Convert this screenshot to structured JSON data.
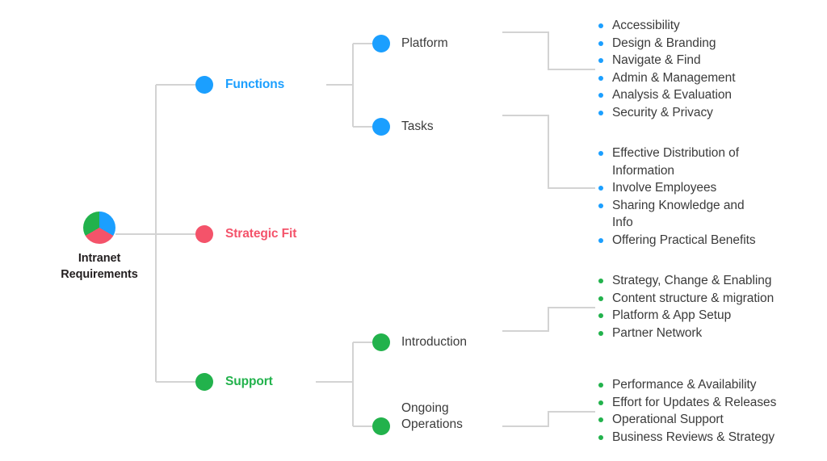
{
  "diagram": {
    "title": "Intranet Requirements mind map",
    "root": {
      "label_line1": "Intranet",
      "label_line2": "Requirements",
      "icon": "pie-chart",
      "segment_colors": [
        "#1b9fff",
        "#f4536a",
        "#22b24c"
      ]
    },
    "colors": {
      "functions": "#1b9fff",
      "strategic_fit": "#f4536a",
      "support": "#22b24c",
      "node_text": "#3b3b3b",
      "root_text": "#231f20",
      "connector": "#d3d3d3"
    },
    "branches": {
      "functions": {
        "label": "Functions",
        "children": {
          "platform": {
            "label": "Platform",
            "items": [
              "Accessibility",
              "Design & Branding",
              "Navigate & Find",
              "Admin & Management",
              "Analysis & Evaluation",
              "Security & Privacy"
            ]
          },
          "tasks": {
            "label": "Tasks",
            "items": [
              "Effective Distribution of Information",
              "Involve Employees",
              "Sharing Knowledge and Info",
              "Offering Practical Benefits"
            ]
          }
        }
      },
      "strategic_fit": {
        "label": "Strategic Fit"
      },
      "support": {
        "label": "Support",
        "children": {
          "introduction": {
            "label": "Introduction",
            "items": [
              "Strategy, Change & Enabling",
              "Content structure & migration",
              "Platform & App Setup",
              "Partner Network"
            ]
          },
          "ongoing_operations": {
            "label": "Ongoing\nOperations",
            "items": [
              "Performance & Availability",
              "Effort for Updates & Releases",
              "Operational Support",
              "Business Reviews & Strategy"
            ]
          }
        }
      }
    }
  }
}
